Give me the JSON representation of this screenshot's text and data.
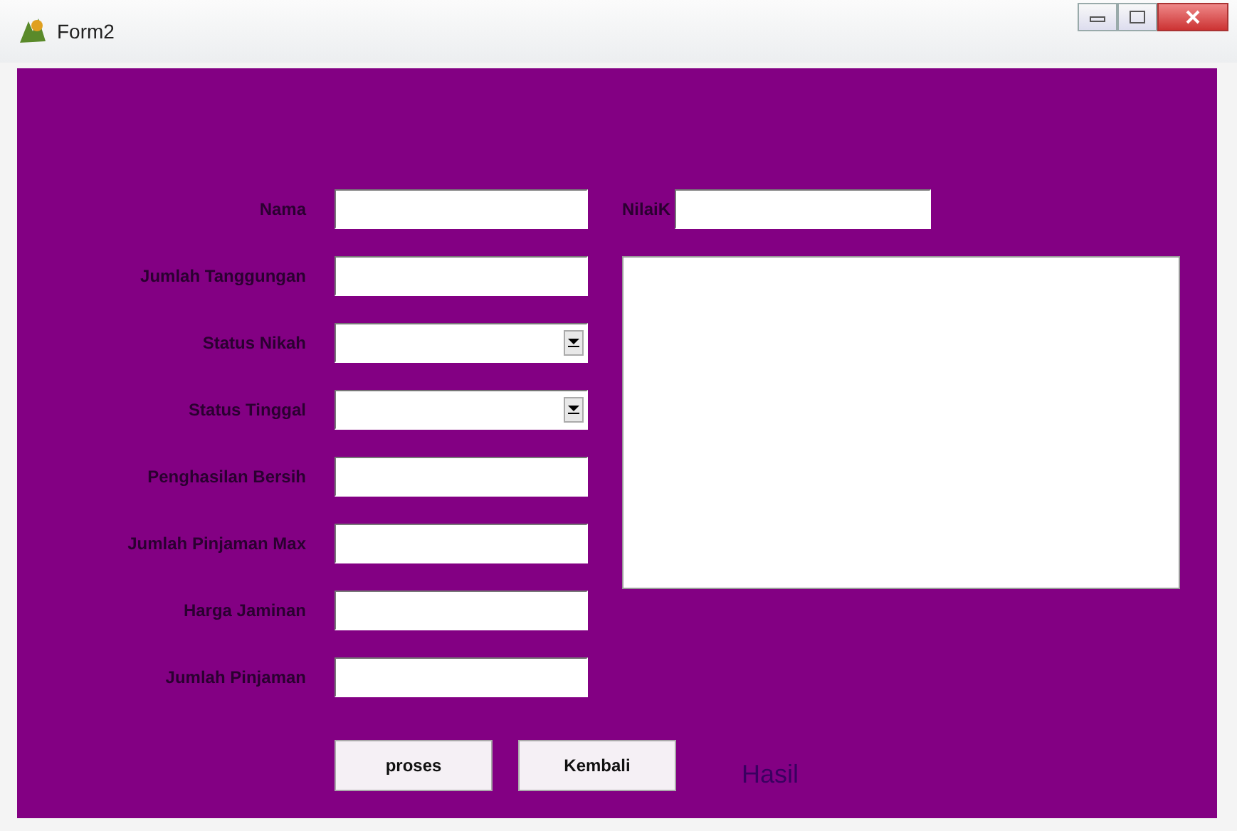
{
  "window": {
    "title": "Form2"
  },
  "fields": [
    {
      "label": "Nama",
      "kind": "text"
    },
    {
      "label": "Jumlah Tanggungan",
      "kind": "text"
    },
    {
      "label": "Status Nikah",
      "kind": "combo"
    },
    {
      "label": "Status Tinggal",
      "kind": "combo"
    },
    {
      "label": "Penghasilan Bersih",
      "kind": "text"
    },
    {
      "label": "Jumlah Pinjaman Max",
      "kind": "text"
    },
    {
      "label": "Harga Jaminan",
      "kind": "text"
    },
    {
      "label": "Jumlah Pinjaman",
      "kind": "text"
    }
  ],
  "nilai_k": {
    "label": "NilaiK"
  },
  "buttons": [
    "proses",
    "Kembali"
  ],
  "result_label": "Hasil"
}
